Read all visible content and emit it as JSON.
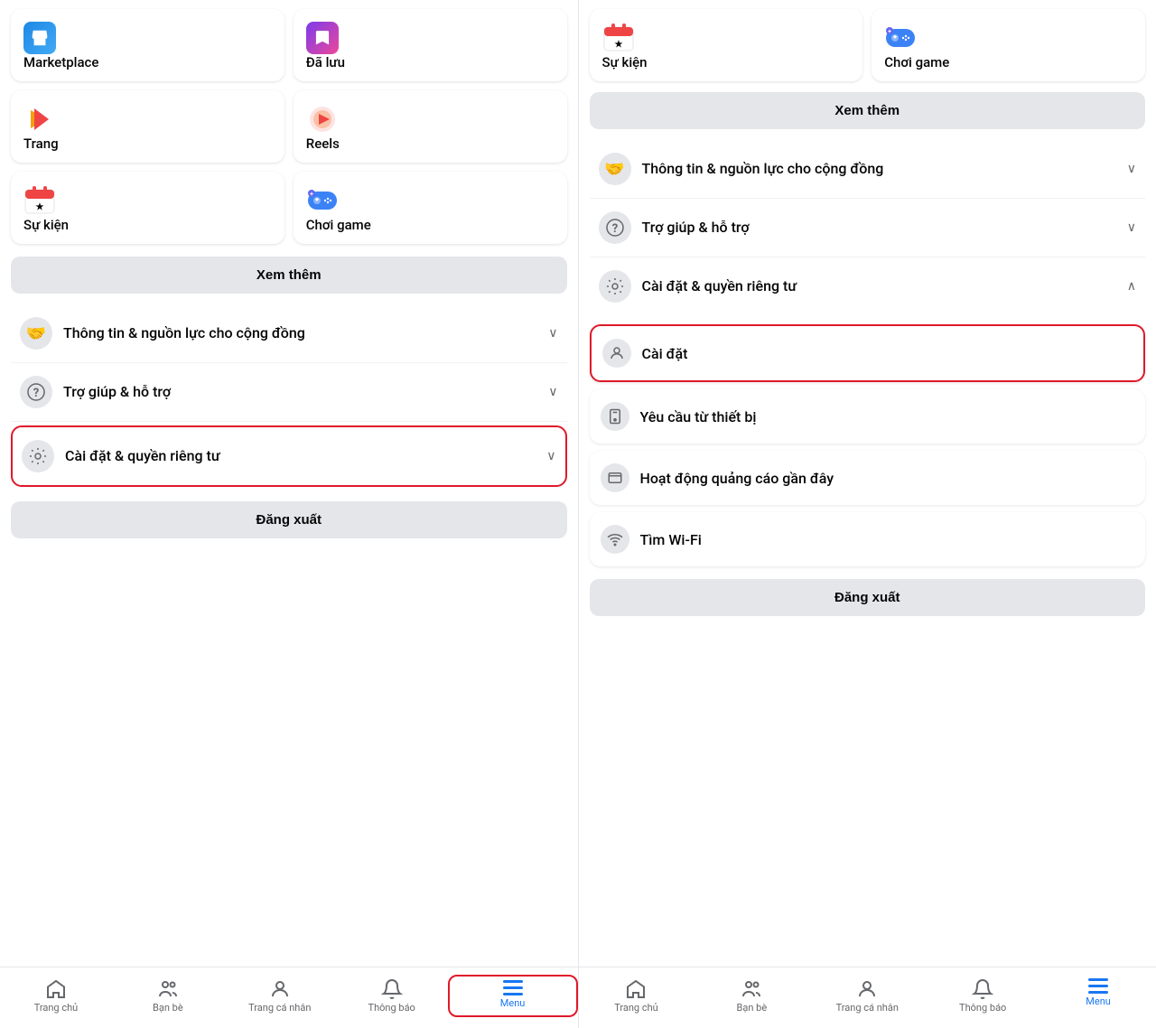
{
  "left_panel": {
    "shortcuts": [
      {
        "id": "marketplace",
        "label": "Marketplace",
        "icon": "🏪",
        "icon_type": "marketplace"
      },
      {
        "id": "saved",
        "label": "Đã lưu",
        "icon": "🔖",
        "icon_type": "saved"
      },
      {
        "id": "page",
        "label": "Trang",
        "icon": "🚩",
        "icon_type": "page"
      },
      {
        "id": "reels",
        "label": "Reels",
        "icon": "▶",
        "icon_type": "reels"
      },
      {
        "id": "events",
        "label": "Sự kiện",
        "icon": "📅",
        "icon_type": "events"
      },
      {
        "id": "games",
        "label": "Chơi game",
        "icon": "🎮",
        "icon_type": "games"
      }
    ],
    "see_more": "Xem thêm",
    "menu_items": [
      {
        "id": "community-info",
        "label": "Thông tin & nguồn lực cho cộng\nđồng",
        "icon": "🤝",
        "has_chevron": true,
        "chevron": "∨"
      },
      {
        "id": "help",
        "label": "Trợ giúp & hỗ trợ",
        "icon": "❓",
        "has_chevron": true,
        "chevron": "∨"
      },
      {
        "id": "settings",
        "label": "Cài đặt & quyền riêng tư",
        "icon": "⚙",
        "has_chevron": true,
        "chevron": "∨",
        "highlighted": true
      }
    ],
    "logout": "Đăng xuất",
    "nav": [
      {
        "id": "home",
        "label": "Trang chủ",
        "icon": "home",
        "active": false
      },
      {
        "id": "friends",
        "label": "Bạn bè",
        "icon": "friends",
        "active": false
      },
      {
        "id": "profile",
        "label": "Trang cá nhân",
        "icon": "profile",
        "active": false
      },
      {
        "id": "notifications",
        "label": "Thông báo",
        "icon": "bell",
        "active": false
      },
      {
        "id": "menu",
        "label": "Menu",
        "icon": "menu",
        "active": true,
        "highlighted": true
      }
    ]
  },
  "right_panel": {
    "partial_top": [
      {
        "id": "events-top",
        "label": "Sự kiện"
      },
      {
        "id": "games-top",
        "label": "Chơi game"
      }
    ],
    "see_more": "Xem thêm",
    "menu_items": [
      {
        "id": "community-info-r",
        "label": "Thông tin & nguồn lực cho cộng\nđồng",
        "icon": "🤝",
        "has_chevron": true,
        "chevron": "∨"
      },
      {
        "id": "help-r",
        "label": "Trợ giúp & hỗ trợ",
        "icon": "❓",
        "has_chevron": true,
        "chevron": "∨"
      },
      {
        "id": "settings-r",
        "label": "Cài đặt & quyền riêng tư",
        "icon": "⚙",
        "has_chevron": true,
        "chevron": "∧",
        "highlighted": false,
        "expanded": true
      }
    ],
    "settings_sub_items": [
      {
        "id": "cai-dat",
        "label": "Cài đặt",
        "icon": "👤",
        "highlighted": true
      },
      {
        "id": "device-request",
        "label": "Yêu cầu từ thiết bị",
        "icon": "📱"
      },
      {
        "id": "ad-activity",
        "label": "Hoạt động quảng cáo gần đây",
        "icon": "🖼"
      },
      {
        "id": "wifi",
        "label": "Tìm Wi-Fi",
        "icon": "📶"
      }
    ],
    "logout": "Đăng xuất",
    "nav": [
      {
        "id": "home-r",
        "label": "Trang chủ",
        "icon": "home",
        "active": false
      },
      {
        "id": "friends-r",
        "label": "Bạn bè",
        "icon": "friends",
        "active": false
      },
      {
        "id": "profile-r",
        "label": "Trang cá nhân",
        "icon": "profile",
        "active": false
      },
      {
        "id": "notifications-r",
        "label": "Thông báo",
        "icon": "bell",
        "active": false
      },
      {
        "id": "menu-r",
        "label": "Menu",
        "icon": "menu",
        "active": true
      }
    ]
  }
}
